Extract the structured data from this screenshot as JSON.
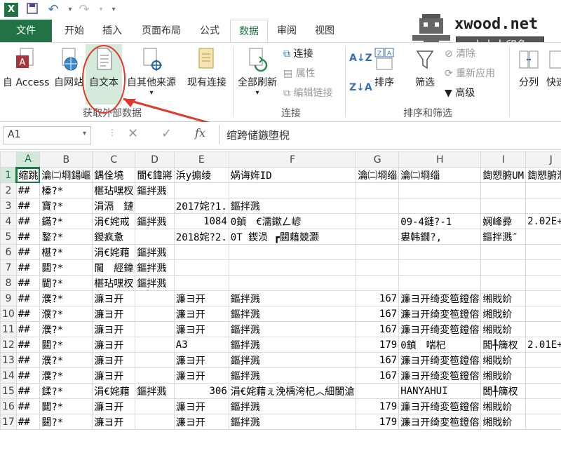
{
  "titlebar": {
    "undo_icon": "undo-icon",
    "redo_icon": "redo-icon"
  },
  "tabs": [
    "文件",
    "开始",
    "插入",
    "页面布局",
    "公式",
    "数据",
    "审阅",
    "视图"
  ],
  "watermark": {
    "site": "xwood.net",
    "name": "小木人印象"
  },
  "ribbon": {
    "from_access": "自 Access",
    "from_web": "自网站",
    "from_text": "自文本",
    "from_other": "自其他来源",
    "existing": "现有连接",
    "group_get": "获取外部数据",
    "refresh_all": "全部刷新",
    "connections": "连接",
    "properties": "属性",
    "edit_links": "编辑链接",
    "group_conn": "连接",
    "sort": "排序",
    "filter": "筛选",
    "clear": "清除",
    "reapply": "重新应用",
    "advanced": "高级",
    "group_sort": "排序和筛选",
    "split": "分列",
    "quick": "快速"
  },
  "formula": {
    "namebox": "A1",
    "fx": "fx",
    "content": "绾跨储鏃堕棿"
  },
  "columns": [
    "A",
    "B",
    "C",
    "D",
    "E",
    "F",
    "G",
    "H",
    "I",
    "J"
  ],
  "rows": [
    {
      "n": "1",
      "c": [
        "缩跳",
        "瀹㈡埛鍚嶇",
        "鍝佺墝",
        "閬€鍏嶈",
        "浜у搧绫",
        "娲诲姩ID",
        "瀹㈡埛缁",
        "瀹㈡埛缁",
        "鍧愬腑UM",
        "鍧愬腑濮"
      ]
    },
    {
      "n": "2",
      "c": [
        "##",
        "榛?*",
        "椹玷嘿杈",
        "鏂拌溅",
        "",
        "",
        "",
        "",
        "",
        ""
      ]
    },
    {
      "n": "3",
      "c": [
        "##",
        "寶?*",
        "涓滆　鏈",
        "",
        "2017姹?1.",
        "鏂拌溅",
        "",
        "",
        "",
        ""
      ]
    },
    {
      "n": "4",
      "c": [
        "##",
        "鏋?*",
        "涓€姹戒",
        "鏂拌溅",
        "1084",
        "0鍞　€濡鏉ㄥ嵃",
        "",
        "09-4鏈?-1",
        "娴峰彛",
        "2.02E+15"
      ]
    },
    {
      "n": "5",
      "c": [
        "##",
        "鐜?*",
        "鍐疯惫",
        "",
        "2018姹?2.",
        "0T 鍥涢 ┏閮藉競灏",
        "",
        "婁韩鐗?,",
        "鏂拌溅″",
        ""
      ]
    },
    {
      "n": "6",
      "c": [
        "##",
        "椹?*",
        "涓€姹藉",
        "鏂拌溅",
        "",
        "",
        "",
        "",
        "",
        ""
      ]
    },
    {
      "n": "7",
      "c": [
        "##",
        "閮?*",
        "閫　經鍏",
        "鏂拌溅",
        "",
        "",
        "",
        "",
        "",
        ""
      ]
    },
    {
      "n": "8",
      "c": [
        "##",
        "閫?*",
        "椹玷嘿杈",
        "鏂拌溅",
        "",
        "",
        "",
        "",
        "",
        ""
      ]
    },
    {
      "n": "9",
      "c": [
        "##",
        "濮?*",
        "濂ヨ开",
        "",
        "濂ヨ开",
        "鏂拌溅",
        "167",
        "濂ヨ开绮変笣鐙傛",
        "缃戝紒",
        ""
      ]
    },
    {
      "n": "10",
      "c": [
        "##",
        "濮?*",
        "濂ヨ开",
        "",
        "濂ヨ开",
        "鏂拌溅",
        "167",
        "濂ヨ开绮変笣鐙傛",
        "缃戝紒",
        ""
      ]
    },
    {
      "n": "11",
      "c": [
        "##",
        "濮?*",
        "濂ヨ开",
        "",
        "濂ヨ开",
        "鏂拌溅",
        "167",
        "濂ヨ开绮変笣鐙傛",
        "缃戝紒",
        ""
      ]
    },
    {
      "n": "12",
      "c": [
        "##",
        "閮?*",
        "濂ヨ开",
        "",
        "A3",
        "鏂拌溅",
        "179",
        "0鍞　喘杞",
        "闆╀簰杈",
        "2.01E+15"
      ]
    },
    {
      "n": "13",
      "c": [
        "##",
        "濮?*",
        "濂ヨ开",
        "",
        "濂ヨ开",
        "鏂拌溅",
        "167",
        "濂ヨ开绮変笣鐙傛",
        "缃戝紒",
        ""
      ]
    },
    {
      "n": "14",
      "c": [
        "##",
        "濮?*",
        "濂ヨ开",
        "",
        "濂ヨ开",
        "鏂拌溅",
        "167",
        "濂ヨ开绮変笣鐙傛",
        "缃戝紒",
        ""
      ]
    },
    {
      "n": "15",
      "c": [
        "##",
        "鍒?*",
        "涓€姹藉",
        "鏂拌溅",
        "306",
        "涓€姹藉ぇ浼楀洿杞︿細閬滄",
        "",
        "HANYAHUI",
        "闆╀簰杈",
        ""
      ]
    },
    {
      "n": "16",
      "c": [
        "##",
        "閮?*",
        "濂ヨ开",
        "",
        "濂ヨ开",
        "鏂拌溅",
        "179",
        "濂ヨ开绮変笣鐙傛",
        "缃戝紒",
        ""
      ]
    },
    {
      "n": "17",
      "c": [
        "##",
        "閮?*",
        "濂ヨ开",
        "",
        "濂ヨ开",
        "鏂拌溅",
        "179",
        "濂ヨ开绮変笣鐙傛",
        "缃戝紒",
        ""
      ]
    }
  ],
  "colors": {
    "accent": "#217346",
    "annotation": "#e0392b"
  }
}
